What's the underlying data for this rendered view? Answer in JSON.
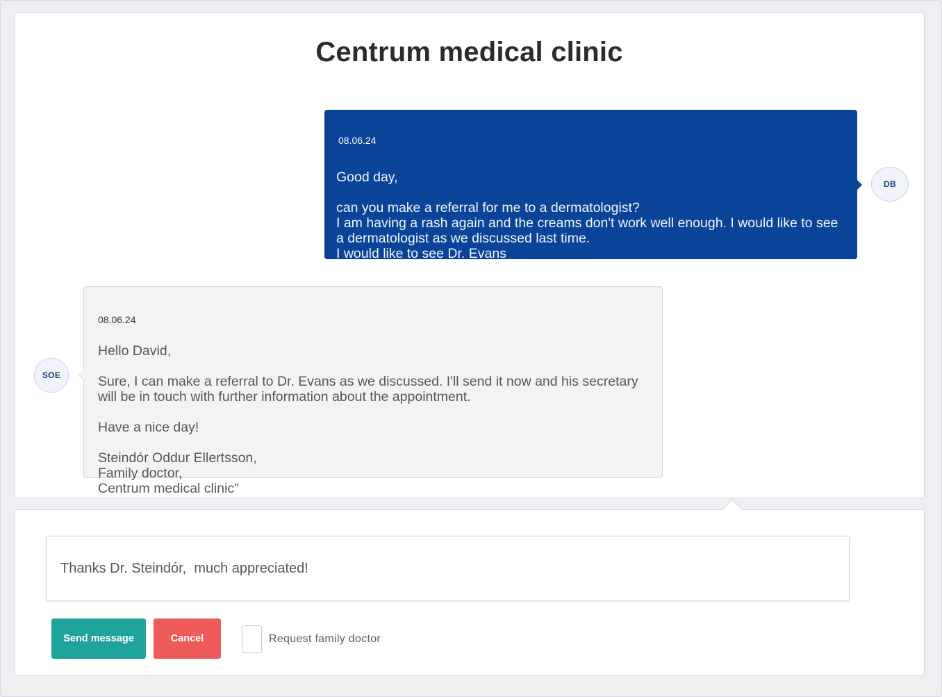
{
  "header": {
    "title": "Centrum medical clinic"
  },
  "messages": [
    {
      "direction": "outgoing",
      "date": "08.06.24",
      "text": "Good day,\n\ncan you make a referral for me to a dermatologist?\nI am having a rash again and the creams don't work well enough. I would like to see a dermatologist as we discussed last time.\nI would like to see Dr. Evans",
      "avatar": "DB"
    },
    {
      "direction": "incoming",
      "date": "08.06.24",
      "text": "Hello David,\n\nSure, I can make a referral to Dr. Evans as we discussed. I'll send it now and his secretary will be in touch with further information about the appointment.\n\nHave a nice day!\n\nSteindór Oddur Ellertsson,\nFamily doctor,\nCentrum medical clinic\"",
      "avatar": "SOE"
    }
  ],
  "compose": {
    "input_value": "Thanks Dr. Steindór,  much appreciated!",
    "send_label": "Send message",
    "cancel_label": "Cancel",
    "checkbox_label": "Request family doctor",
    "checkbox_checked": false
  },
  "colors": {
    "outgoing_bubble": "#0a4499",
    "incoming_bubble": "#f4f3f4",
    "send_button": "#20a39a",
    "cancel_button": "#ef5b5b"
  }
}
